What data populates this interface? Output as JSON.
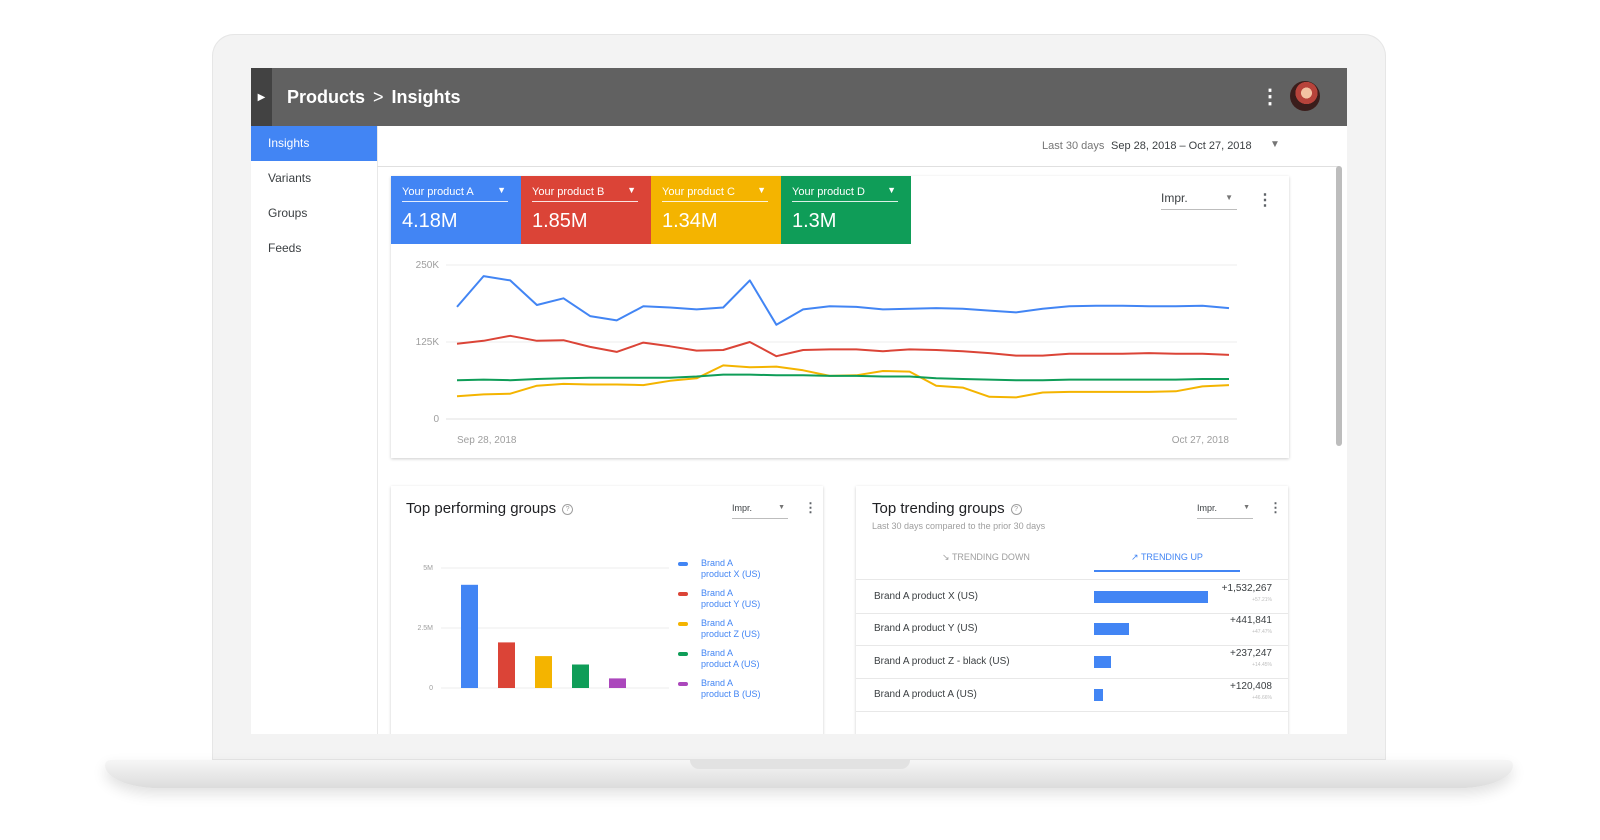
{
  "header": {
    "breadcrumb_parent": "Products",
    "breadcrumb_separator": ">",
    "breadcrumb_current": "Insights"
  },
  "sidebar": {
    "items": [
      {
        "label": "Insights",
        "active": true
      },
      {
        "label": "Variants",
        "active": false
      },
      {
        "label": "Groups",
        "active": false
      },
      {
        "label": "Feeds",
        "active": false
      }
    ]
  },
  "date_range": {
    "label": "Last 30 days",
    "value": "Sep 28, 2018 – Oct 27, 2018"
  },
  "colors": {
    "blue": "#4285f4",
    "red": "#db4437",
    "yellow": "#f4b400",
    "green": "#0f9d58",
    "purple": "#ab47bc"
  },
  "main_chart": {
    "metric": "Impr.",
    "tiles": [
      {
        "name": "Your product A",
        "value": "4.18M",
        "color": "#4285f4"
      },
      {
        "name": "Your product B",
        "value": "1.85M",
        "color": "#db4437"
      },
      {
        "name": "Your product C",
        "value": "1.34M",
        "color": "#f4b400"
      },
      {
        "name": "Your product D",
        "value": "1.3M",
        "color": "#0f9d58"
      }
    ],
    "y_ticks": [
      "250K",
      "125K",
      "0"
    ],
    "x_start": "Sep 28, 2018",
    "x_end": "Oct 27, 2018"
  },
  "top_performing": {
    "title": "Top performing groups",
    "metric": "Impr.",
    "y_ticks": [
      "5M",
      "2.5M",
      "0"
    ],
    "legend": [
      {
        "line1": "Brand A",
        "line2": "product X (US)",
        "color": "#4285f4"
      },
      {
        "line1": "Brand A",
        "line2": "product Y (US)",
        "color": "#db4437"
      },
      {
        "line1": "Brand A",
        "line2": "product Z (US)",
        "color": "#f4b400"
      },
      {
        "line1": "Brand A",
        "line2": "product A (US)",
        "color": "#0f9d58"
      },
      {
        "line1": "Brand A",
        "line2": "product B (US)",
        "color": "#ab47bc"
      }
    ]
  },
  "top_trending": {
    "title": "Top trending groups",
    "subtitle": "Last 30 days compared to the prior 30 days",
    "metric": "Impr.",
    "tab_down": "TRENDING DOWN",
    "tab_up": "TRENDING UP",
    "rows": [
      {
        "name": "Brand A product X (US)",
        "value": "+1,532,267",
        "pct": "+57.21%",
        "share": 1.0
      },
      {
        "name": "Brand A product Y (US)",
        "value": "+441,841",
        "pct": "+47.47%",
        "share": 0.31
      },
      {
        "name": "Brand A product Z - black (US)",
        "value": "+237,247",
        "pct": "+14.45%",
        "share": 0.15
      },
      {
        "name": "Brand A product A (US)",
        "value": "+120,408",
        "pct": "+46.66%",
        "share": 0.08
      }
    ]
  },
  "chart_data": [
    {
      "type": "line",
      "x_labels": [
        "Sep 28, 2018",
        "Oct 27, 2018"
      ],
      "ylim": [
        0,
        250000
      ],
      "y_ticks": [
        0,
        125000,
        250000
      ],
      "grid": true,
      "series": [
        {
          "name": "Your product A",
          "color": "#4285f4",
          "values": [
            182000,
            232000,
            225000,
            185000,
            196000,
            167000,
            160000,
            183000,
            181000,
            178000,
            181000,
            225000,
            153000,
            178000,
            183000,
            182000,
            178000,
            179000,
            180000,
            179000,
            176000,
            173000,
            179000,
            183000,
            184000,
            184000,
            183000,
            183000,
            184000,
            180000
          ]
        },
        {
          "name": "Your product B",
          "color": "#db4437",
          "values": [
            122000,
            127000,
            135000,
            127000,
            128000,
            117000,
            109000,
            124000,
            118000,
            111000,
            112000,
            125000,
            102000,
            112000,
            113000,
            113000,
            110000,
            113000,
            112000,
            110000,
            107000,
            103000,
            103000,
            106000,
            106000,
            106000,
            107000,
            106000,
            106000,
            104000
          ]
        },
        {
          "name": "Your product C",
          "color": "#f4b400",
          "values": [
            37000,
            40000,
            41000,
            54000,
            57000,
            56000,
            56000,
            55000,
            62000,
            66000,
            87000,
            84000,
            85000,
            79000,
            70000,
            71000,
            78000,
            77000,
            54000,
            51000,
            36000,
            35000,
            43000,
            44000,
            44000,
            44000,
            44000,
            45000,
            53000,
            55000
          ]
        },
        {
          "name": "Your product D",
          "color": "#0f9d58",
          "values": [
            63000,
            64000,
            63000,
            65000,
            66000,
            67000,
            67000,
            67000,
            67000,
            69000,
            72000,
            72000,
            71000,
            71000,
            70000,
            70000,
            69000,
            69000,
            66000,
            65000,
            64000,
            63000,
            63000,
            64000,
            64000,
            64000,
            64000,
            64000,
            65000,
            65000
          ]
        }
      ]
    },
    {
      "type": "bar",
      "ylim": [
        0,
        5000000
      ],
      "y_ticks": [
        "5M",
        "2.5M",
        "0"
      ],
      "categories": [
        "Brand A product X (US)",
        "Brand A product Y (US)",
        "Brand A product Z (US)",
        "Brand A product A (US)",
        "Brand A product B (US)"
      ],
      "values": [
        4300000,
        1900000,
        1330000,
        980000,
        400000
      ],
      "colors": [
        "#4285f4",
        "#db4437",
        "#f4b400",
        "#0f9d58",
        "#ab47bc"
      ]
    }
  ]
}
